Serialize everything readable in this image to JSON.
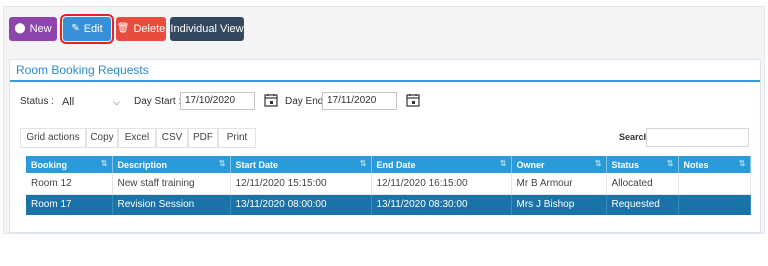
{
  "toolbar": {
    "new_label": "New",
    "edit_label": "Edit",
    "delete_label": "Delete",
    "individual_view_label": "Individual View"
  },
  "panel": {
    "title": "Room Booking Requests"
  },
  "filters": {
    "status_label": "Status :",
    "status_value": "All",
    "day_start_label": "Day Start :",
    "day_start_value": "17/10/2020",
    "day_end_label": "Day End :",
    "day_end_value": "17/11/2020"
  },
  "grid_actions": {
    "label": "Grid actions",
    "buttons": [
      "Copy",
      "Excel",
      "CSV",
      "PDF",
      "Print"
    ],
    "search_label": "Search:"
  },
  "table": {
    "columns": [
      "Booking",
      "Description",
      "Start Date",
      "End Date",
      "Owner",
      "Status",
      "Notes"
    ],
    "rows": [
      [
        "Room 12",
        "New staff training",
        "12/11/2020 15:15:00",
        "12/11/2020 16:15:00",
        "Mr B Armour",
        "Allocated",
        ""
      ],
      [
        "Room 17",
        "Revision Session",
        "13/11/2020 08:00:00",
        "13/11/2020 08:30:00",
        "Mrs J Bishop",
        "Requested",
        ""
      ]
    ]
  },
  "colors": {
    "new": "#8e44ad",
    "edit": "#3a8fd9",
    "delete": "#e74c3c",
    "individual_view": "#34495e",
    "header": "#2b9ad9",
    "selected_row": "#1a73a8"
  }
}
